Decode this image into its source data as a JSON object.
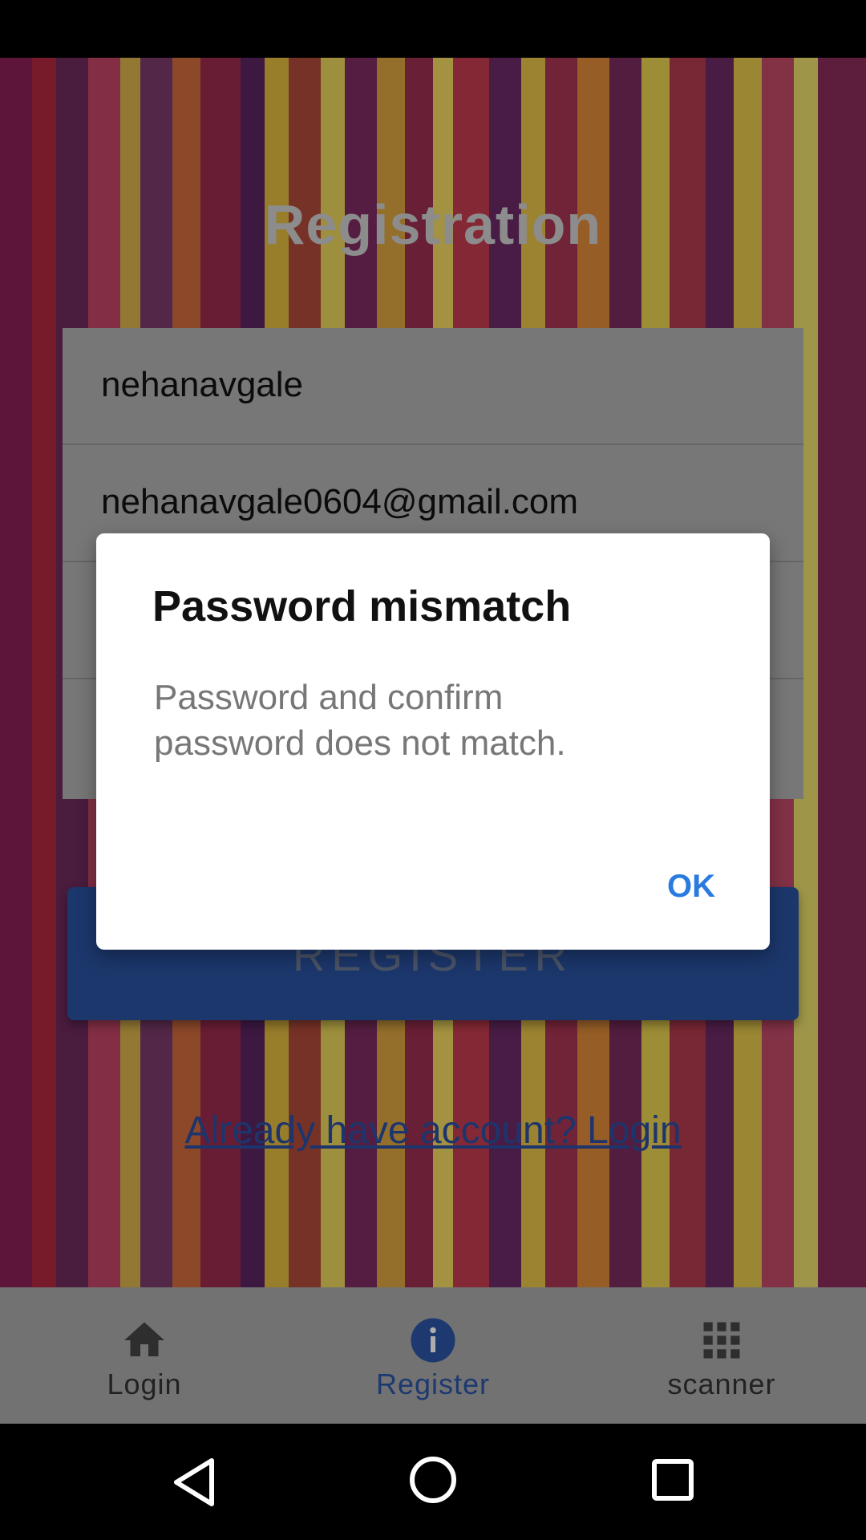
{
  "registration": {
    "title": "Registration",
    "fields": [
      {
        "name": "username",
        "value": "nehanavgale"
      },
      {
        "name": "email",
        "value": "nehanavgale0604@gmail.com"
      },
      {
        "name": "password",
        "value": ""
      },
      {
        "name": "confirm_password",
        "value": ""
      }
    ],
    "register_label": "REGISTER",
    "login_link": "Already have account? Login"
  },
  "dialog": {
    "title": "Password mismatch",
    "message": "Password and confirm password does not match.",
    "ok_label": "OK"
  },
  "bottom_nav": {
    "items": [
      {
        "label": "Login",
        "icon": "home-icon",
        "active": false
      },
      {
        "label": "Register",
        "icon": "info-icon",
        "active": true
      },
      {
        "label": "scanner",
        "icon": "grid-icon",
        "active": false
      }
    ]
  },
  "colors": {
    "accent": "#2a7be0",
    "nav_active": "#2c55a5",
    "button": "#2a52a0"
  }
}
